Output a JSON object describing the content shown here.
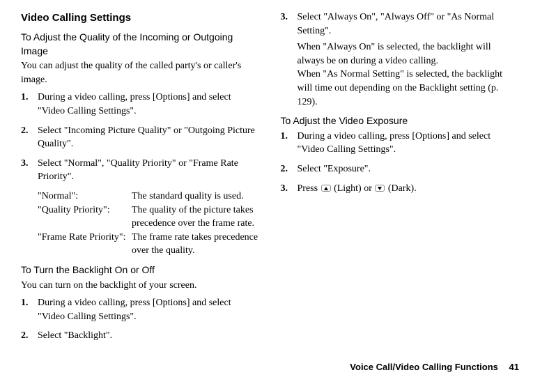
{
  "left": {
    "heading": "Video Calling Settings",
    "sub1_title": "To Adjust the Quality of the Incoming or Outgoing Image",
    "sub1_intro": "You can adjust the quality of the called party's or caller's image.",
    "sub1_steps": [
      "During a video calling, press [Options] and select \"Video Calling Settings\".",
      "Select \"Incoming Picture Quality\" or \"Outgoing Picture Quality\".",
      "Select \"Normal\", \"Quality Priority\" or \"Frame Rate Priority\"."
    ],
    "defs": [
      {
        "key": "\"Normal\":",
        "val": "The standard quality is used."
      },
      {
        "key": "\"Quality Priority\":",
        "val": "The quality of the picture takes precedence over the frame rate."
      },
      {
        "key": "\"Frame Rate Priority\":",
        "val": "The frame rate takes precedence over the quality."
      }
    ],
    "sub2_title": "To Turn the Backlight On or Off",
    "sub2_intro": "You can turn on the backlight of your screen.",
    "sub2_steps": [
      "During a video calling, press [Options] and select \"Video Calling Settings\".",
      "Select \"Backlight\"."
    ]
  },
  "right": {
    "step3_head": "Select \"Always On\", \"Always Off\" or \"As Normal Setting\".",
    "step3_body1": "When \"Always On\" is selected, the backlight will always be on during a video calling.",
    "step3_body2": "When \"As Normal Setting\" is selected, the backlight will time out depending on the Backlight setting (p. 129).",
    "sub3_title": "To Adjust the Video Exposure",
    "sub3_steps": [
      "During a video calling, press [Options] and select \"Video Calling Settings\".",
      "Select \"Exposure\"."
    ],
    "step3c_prefix": "Press ",
    "step3c_light": " (Light) or ",
    "step3c_dark": " (Dark)."
  },
  "footer": {
    "title": "Voice Call/Video Calling Functions",
    "page": "41"
  }
}
